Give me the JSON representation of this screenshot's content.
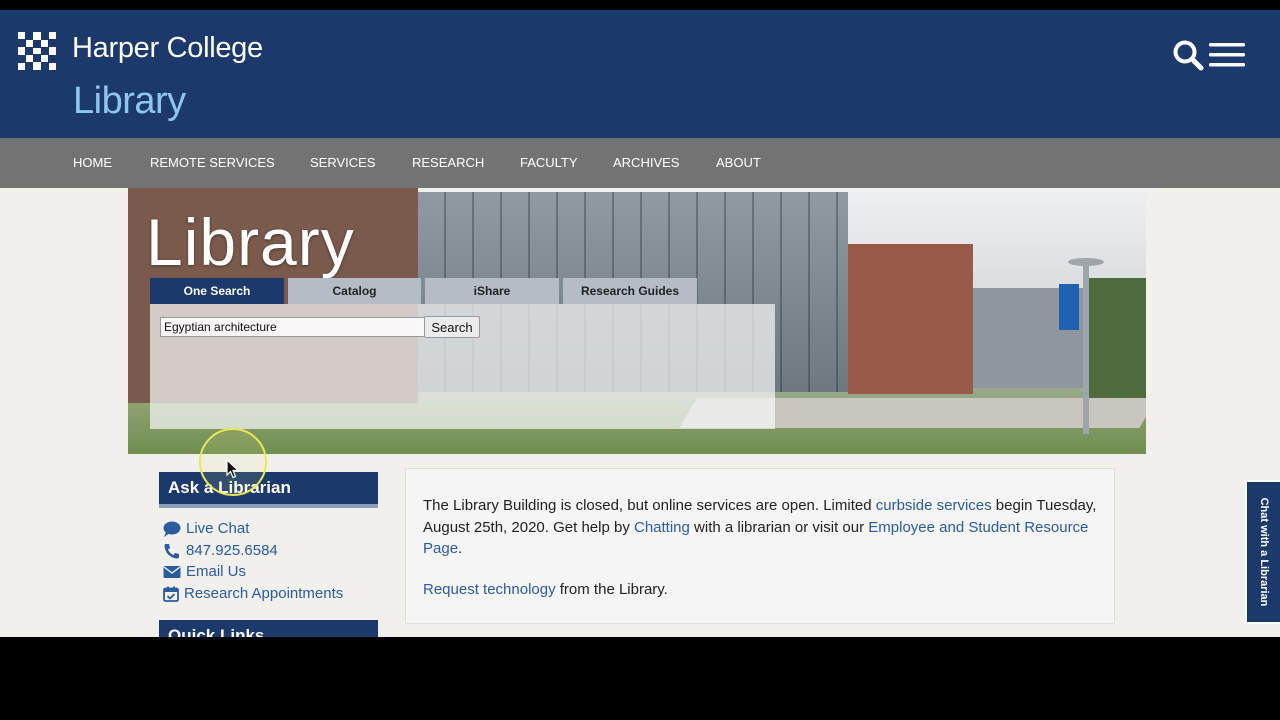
{
  "header": {
    "college_name": "Harper College",
    "site_title": "Library",
    "icons": [
      "harper-logo-icon",
      "search-icon",
      "hamburger-menu-icon"
    ],
    "brand_color": "#1b3a6b",
    "accent_color": "#8dc6ee"
  },
  "nav": {
    "items": [
      "HOME",
      "REMOTE SERVICES",
      "SERVICES",
      "RESEARCH",
      "FACULTY",
      "ARCHIVES",
      "ABOUT"
    ]
  },
  "hero": {
    "title": "Library",
    "tabs": [
      {
        "label": "One Search",
        "active": true
      },
      {
        "label": "Catalog",
        "active": false
      },
      {
        "label": "iShare",
        "active": false
      },
      {
        "label": "Research Guides",
        "active": false
      }
    ],
    "search": {
      "value": "Egyptian architecture",
      "button_label": "Search"
    }
  },
  "sidebar": {
    "ask_header": "Ask a Librarian",
    "contacts": [
      {
        "label": "Live Chat",
        "icon": "chat-bubble-icon"
      },
      {
        "label": "847.925.6584",
        "icon": "phone-icon"
      },
      {
        "label": "Email Us",
        "icon": "envelope-icon"
      },
      {
        "label": "Research Appointments",
        "icon": "calendar-check-icon"
      }
    ],
    "quick_links_header": "Quick Links"
  },
  "notice": {
    "part1": "The Library Building is closed, but online services are open. Limited ",
    "link1": "curbside services",
    "part2": " begin Tuesday, August 25th, 2020. Get help by ",
    "link2": "Chatting",
    "part3": " with a librarian or visit our ",
    "link3": "Employee and Student Resource Page",
    "part4": ".",
    "tech_link": "Request technology",
    "tech_text": " from the Library."
  },
  "chat_widget": {
    "label": "Chat with a Librarian"
  }
}
